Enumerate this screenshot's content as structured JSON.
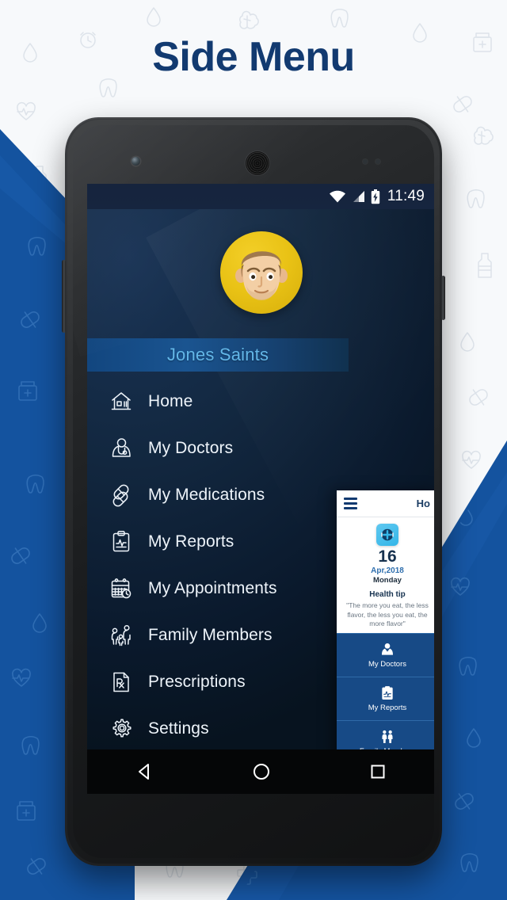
{
  "page": {
    "title": "Side Menu",
    "title_color": "#123a70",
    "background_color": "#f7f9fb",
    "accent_blue": "#14539f"
  },
  "phone": {
    "status_bar": {
      "time": "11:49",
      "icons": [
        "wifi-icon",
        "cellular-signal-icon",
        "battery-charging-icon"
      ]
    },
    "nav_bar": {
      "back_label": "Back",
      "home_label": "Home",
      "recents_label": "Recents",
      "icons": [
        "back-triangle-icon",
        "home-circle-icon",
        "recents-square-icon"
      ]
    },
    "hardware": [
      "front-camera",
      "earpiece-speaker",
      "proximity-sensor",
      "volume-rocker",
      "power-button"
    ]
  },
  "drawer": {
    "avatar": {
      "name": "avatar",
      "background_color": "#e9c215"
    },
    "user_name": "Jones Saints",
    "user_name_color": "#63b7e8",
    "items": [
      {
        "label": "Home",
        "icon": "home-icon"
      },
      {
        "label": "My Doctors",
        "icon": "doctor-icon"
      },
      {
        "label": "My Medications",
        "icon": "capsule-pills-icon"
      },
      {
        "label": "My Reports",
        "icon": "clipboard-chart-icon"
      },
      {
        "label": "My Appointments",
        "icon": "calendar-clock-icon"
      },
      {
        "label": "Family Members",
        "icon": "family-icon"
      },
      {
        "label": "Prescriptions",
        "icon": "prescription-rx-icon"
      },
      {
        "label": "Settings",
        "icon": "gear-icon"
      }
    ]
  },
  "preview_card": {
    "menu_icon": "hamburger-menu-icon",
    "title": "Ho",
    "date_icon": "medical-cross-icon",
    "day_number": "16",
    "month_year": "Apr,2018",
    "weekday": "Monday",
    "tip_heading": "Health tip",
    "tip_text": "\"The more you eat, the less flavor, the less you eat, the more flavor\"",
    "tiles": [
      {
        "label": "My Doctors",
        "icon": "doctor-icon"
      },
      {
        "label": "My Reports",
        "icon": "clipboard-chart-icon"
      },
      {
        "label": "Family Members",
        "icon": "family-icon"
      }
    ]
  }
}
